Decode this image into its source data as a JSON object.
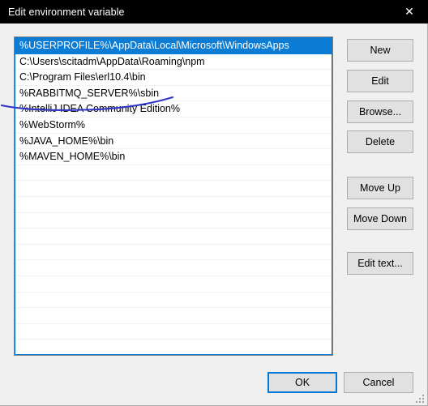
{
  "window": {
    "title": "Edit environment variable",
    "close_label": "✕",
    "titlebar_color": "#000000",
    "body_color": "#f0f0f0"
  },
  "list": {
    "selected_index": 0,
    "selection_color": "#0c7cd5",
    "focus_border_color": "#0078d7",
    "items": [
      "%USERPROFILE%\\AppData\\Local\\Microsoft\\WindowsApps",
      "C:\\Users\\scitadm\\AppData\\Roaming\\npm",
      "C:\\Program Files\\erl10.4\\bin",
      "%RABBITMQ_SERVER%\\sbin",
      "%IntelliJ IDEA Community Edition%",
      "%WebStorm%",
      "%JAVA_HOME%\\bin",
      "%MAVEN_HOME%\\bin"
    ]
  },
  "annotation": {
    "kind": "hand-drawn-underline",
    "color": "#2f35c8",
    "targets_item_index": 3
  },
  "side_buttons": [
    {
      "id": "new",
      "label": "New"
    },
    {
      "id": "edit",
      "label": "Edit"
    },
    {
      "id": "browse",
      "label": "Browse..."
    },
    {
      "id": "delete",
      "label": "Delete"
    },
    {
      "id": "moveup",
      "label": "Move Up"
    },
    {
      "id": "movedown",
      "label": "Move Down"
    },
    {
      "id": "edittext",
      "label": "Edit text..."
    }
  ],
  "footer": {
    "ok_label": "OK",
    "cancel_label": "Cancel",
    "default_button": "OK"
  }
}
